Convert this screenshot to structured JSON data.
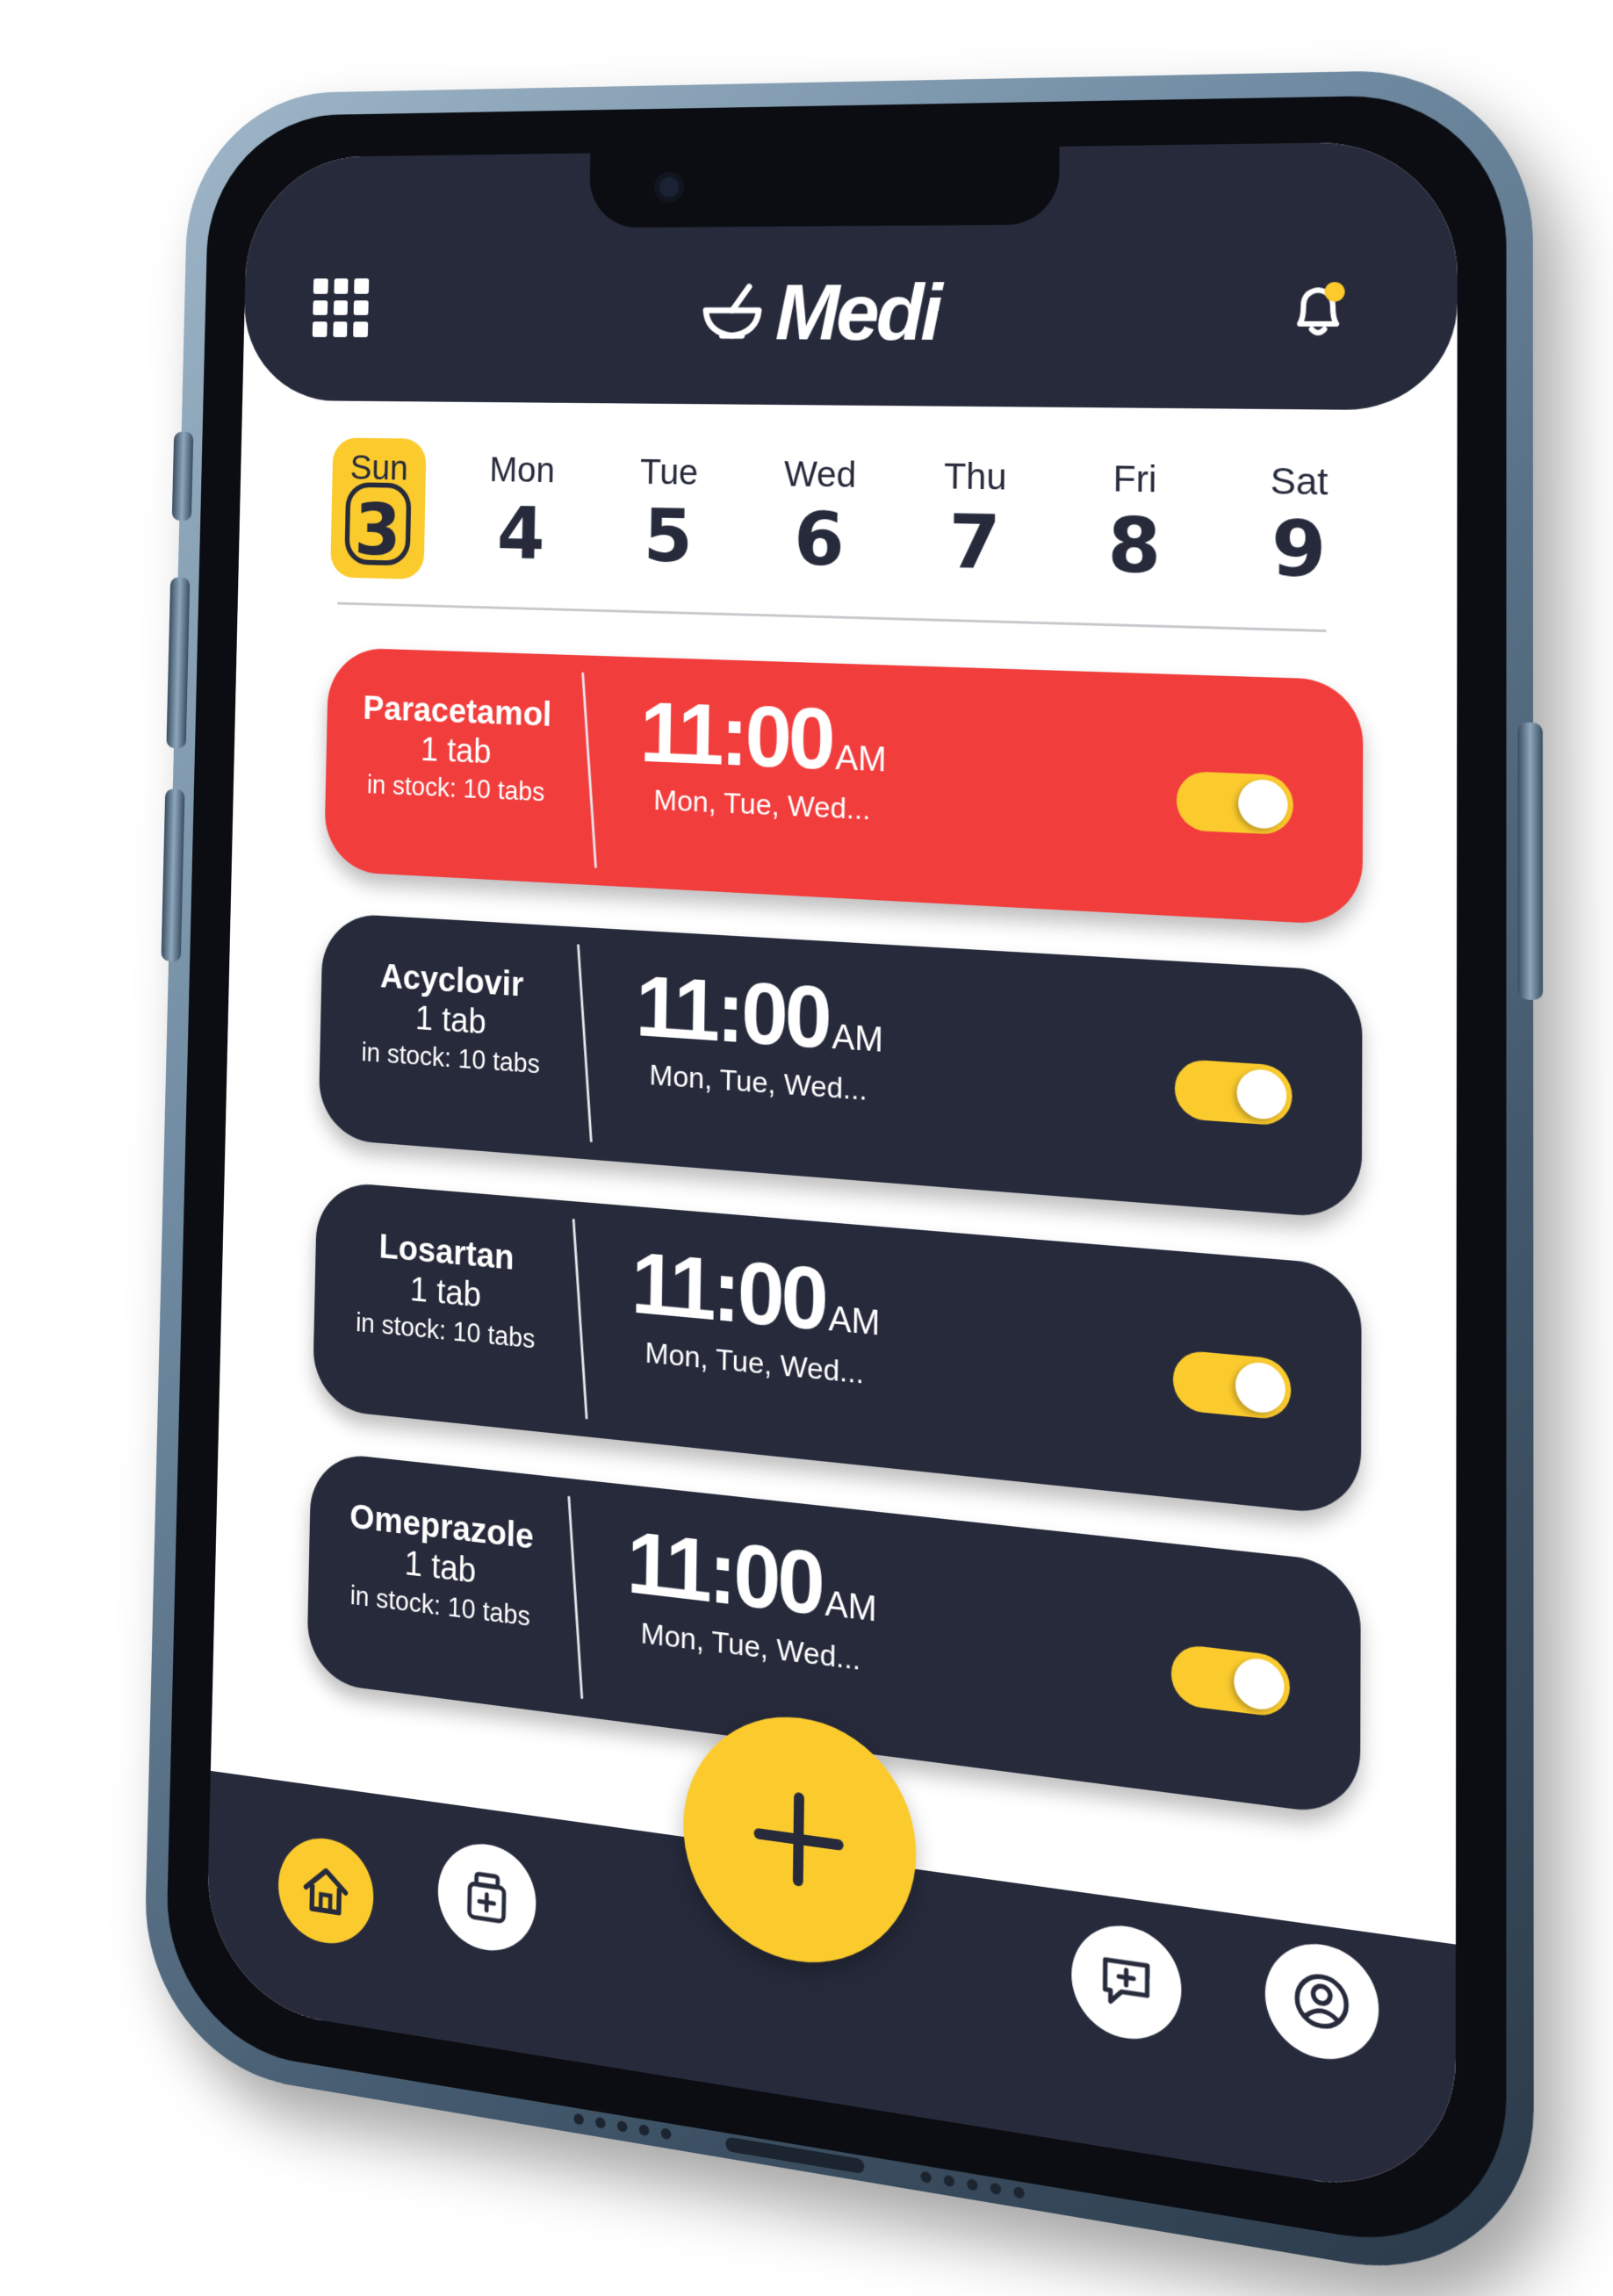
{
  "app": {
    "name": "Medi",
    "accent_color": "#fbcb2e",
    "dark_color": "#262a3b",
    "alert_color": "#f23d3d"
  },
  "header": {
    "menu_icon": "grid-menu-icon",
    "logo_icon": "mortar-pestle-icon",
    "logo_text": "Medi",
    "notification_icon": "bell-icon"
  },
  "week": [
    {
      "name": "Sun",
      "num": "3",
      "selected": true
    },
    {
      "name": "Mon",
      "num": "4",
      "selected": false
    },
    {
      "name": "Tue",
      "num": "5",
      "selected": false
    },
    {
      "name": "Wed",
      "num": "6",
      "selected": false
    },
    {
      "name": "Thu",
      "num": "7",
      "selected": false
    },
    {
      "name": "Fri",
      "num": "8",
      "selected": false
    },
    {
      "name": "Sat",
      "num": "9",
      "selected": false
    }
  ],
  "medications": [
    {
      "name": "Paracetamol",
      "dose": "1 tab",
      "stock": "in stock: 10 tabs",
      "time": "11:00",
      "ampm": "AM",
      "days": "Mon, Tue, Wed...",
      "enabled": true,
      "highlight": true
    },
    {
      "name": "Acyclovir",
      "dose": "1 tab",
      "stock": "in stock: 10 tabs",
      "time": "11:00",
      "ampm": "AM",
      "days": "Mon, Tue, Wed...",
      "enabled": true,
      "highlight": false
    },
    {
      "name": "Losartan",
      "dose": "1 tab",
      "stock": "in stock: 10 tabs",
      "time": "11:00",
      "ampm": "AM",
      "days": "Mon, Tue, Wed...",
      "enabled": true,
      "highlight": false
    },
    {
      "name": "Omeprazole",
      "dose": "1 tab",
      "stock": "in stock: 10 tabs",
      "time": "11:00",
      "ampm": "AM",
      "days": "Mon, Tue, Wed...",
      "enabled": true,
      "highlight": false
    }
  ],
  "bottom_nav": {
    "items": [
      "home-icon",
      "medicine-box-icon",
      "add-icon",
      "chat-plus-icon",
      "profile-icon"
    ],
    "active": "home-icon"
  }
}
